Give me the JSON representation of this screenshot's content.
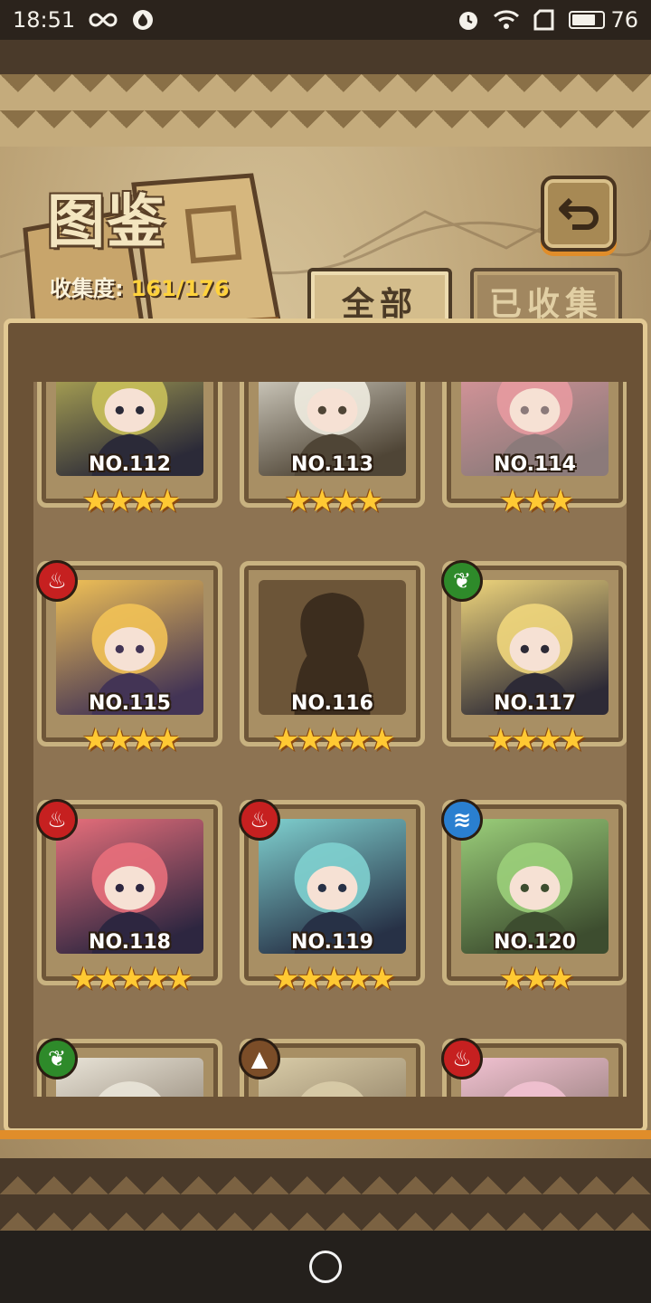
{
  "status_bar": {
    "time": "18:51",
    "battery": "76",
    "battery_level": 0.76,
    "icons": [
      "infinity-icon",
      "app-notification-icon",
      "alarm-icon",
      "wifi-icon",
      "sim-icon",
      "battery-icon"
    ]
  },
  "header": {
    "title": "图鉴",
    "collection_label": "收集度:",
    "collection_value": "161/176"
  },
  "tabs": [
    {
      "label": "全部",
      "selected": true
    },
    {
      "label": "已收集",
      "selected": false
    }
  ],
  "cards": [
    {
      "no": "NO.112",
      "stars": "★★★★",
      "element": null,
      "colors": [
        "#2b2a38",
        "#c9c05a"
      ]
    },
    {
      "no": "NO.113",
      "stars": "★★★★",
      "element": null,
      "colors": [
        "#4f4536",
        "#efece0"
      ]
    },
    {
      "no": "NO.114",
      "stars": "★★★",
      "element": null,
      "colors": [
        "#8b7a7a",
        "#e79aa0"
      ]
    },
    {
      "no": "NO.115",
      "stars": "★★★★",
      "element": "fire",
      "colors": [
        "#433455",
        "#f2c256"
      ]
    },
    {
      "no": "NO.116",
      "stars": "★★★★★",
      "element": null,
      "colors": [
        "#3c2d1e",
        "#3c2d1e"
      ],
      "locked": true
    },
    {
      "no": "NO.117",
      "stars": "★★★★",
      "element": "leaf",
      "colors": [
        "#2d2a36",
        "#f0d67c"
      ]
    },
    {
      "no": "NO.118",
      "stars": "★★★★★",
      "element": "fire",
      "colors": [
        "#2d2640",
        "#e86f7b"
      ]
    },
    {
      "no": "NO.119",
      "stars": "★★★★★",
      "element": "fire",
      "colors": [
        "#273146",
        "#7fd0cf"
      ]
    },
    {
      "no": "NO.120",
      "stars": "★★★",
      "element": "water",
      "colors": [
        "#3d4d2f",
        "#9bcf7a"
      ]
    },
    {
      "no": "",
      "stars": "",
      "element": "leaf",
      "colors": [
        "#7b6d5c",
        "#e9e4d8"
      ]
    },
    {
      "no": "",
      "stars": "",
      "element": "earth",
      "colors": [
        "#7b6a52",
        "#d9cca8"
      ]
    },
    {
      "no": "",
      "stars": "",
      "element": "fire",
      "colors": [
        "#7a6a62",
        "#f2c2d2"
      ]
    }
  ],
  "element_styles": {
    "fire": {
      "bg": "#c62020",
      "glyph": "♨"
    },
    "leaf": {
      "bg": "#2e8a2a",
      "glyph": "❦"
    },
    "water": {
      "bg": "#2a7fd0",
      "glyph": "≋"
    },
    "earth": {
      "bg": "#7b4d28",
      "glyph": "▲"
    }
  }
}
